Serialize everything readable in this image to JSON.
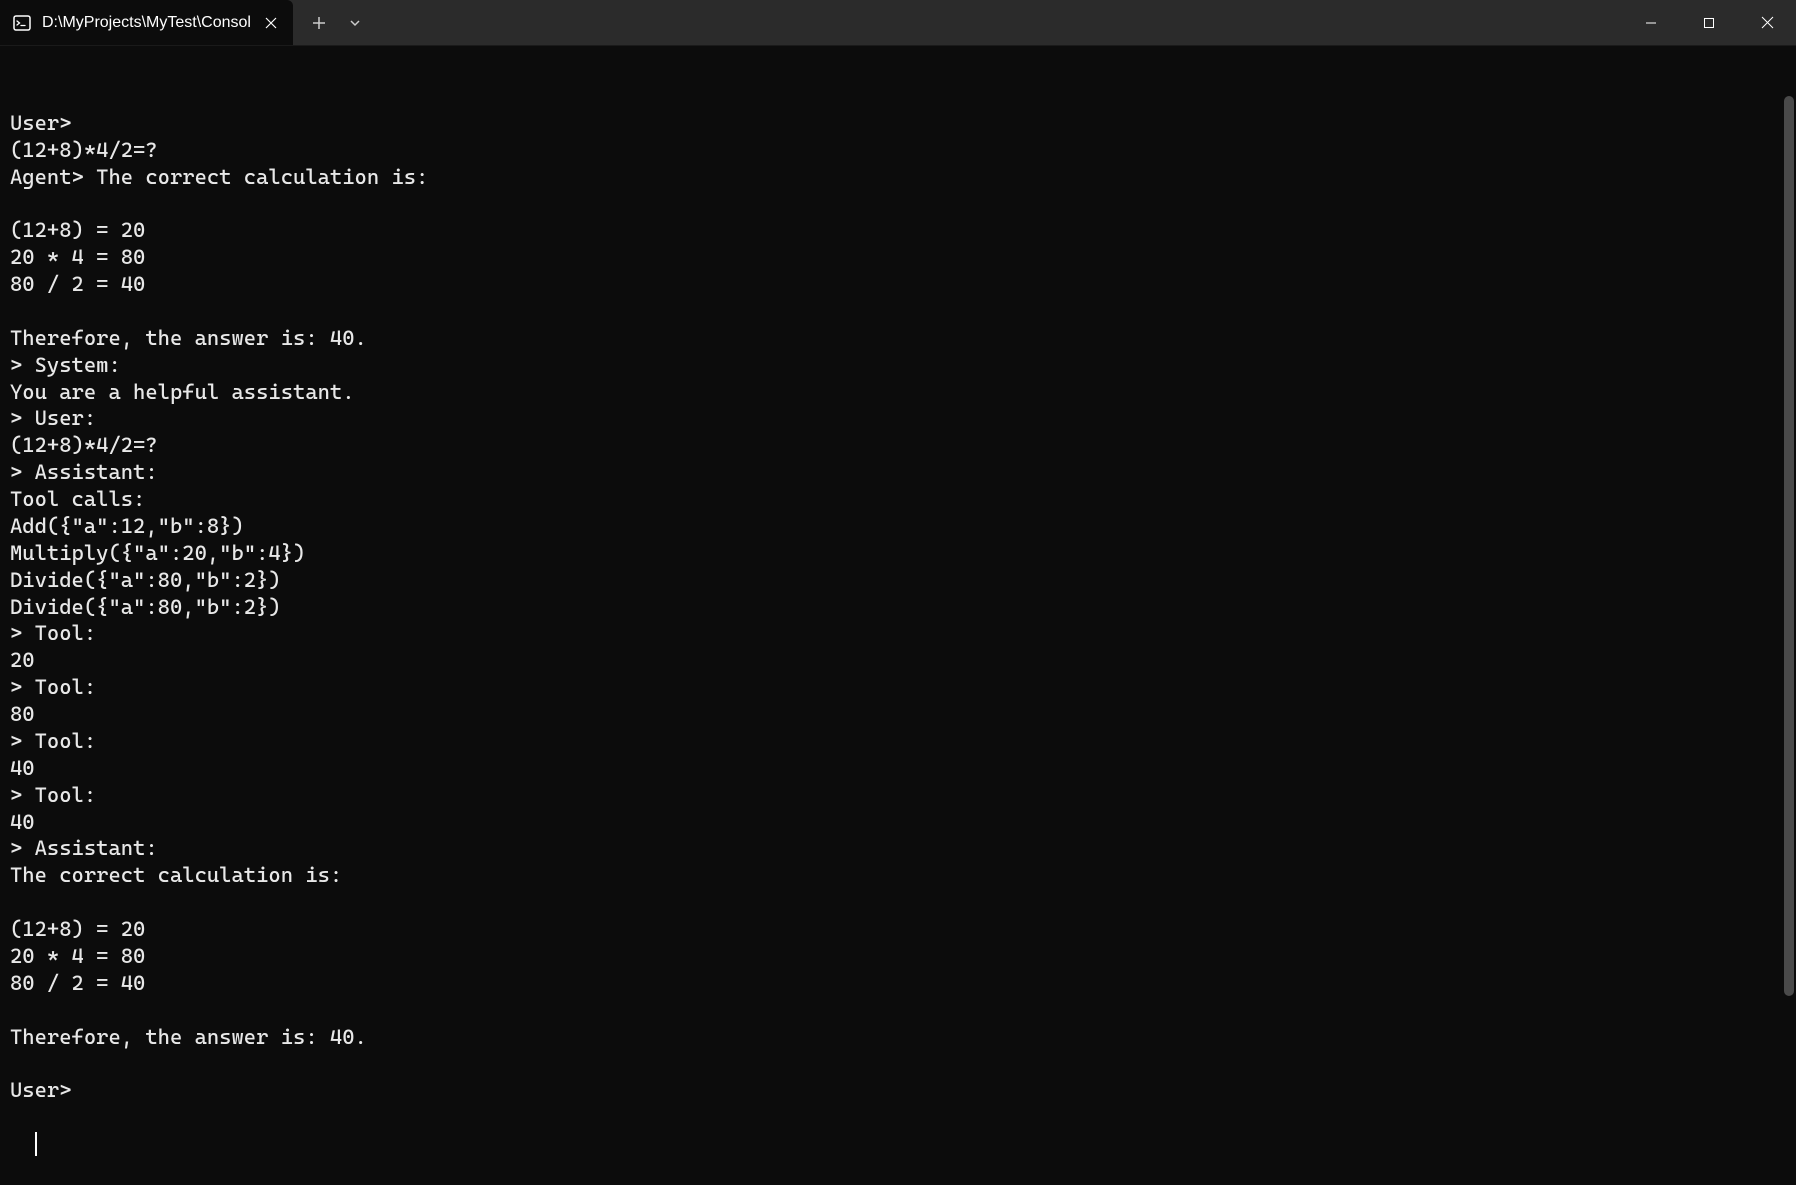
{
  "titlebar": {
    "tab_title": "D:\\MyProjects\\MyTest\\Consol"
  },
  "terminal": {
    "lines": [
      "User>",
      "(12+8)*4/2=?",
      "Agent> The correct calculation is:",
      "",
      "(12+8) = 20",
      "20 * 4 = 80",
      "80 / 2 = 40",
      "",
      "Therefore, the answer is: 40.",
      "> System:",
      "You are a helpful assistant.",
      "> User:",
      "(12+8)*4/2=?",
      "> Assistant:",
      "Tool calls:",
      "Add({\"a\":12,\"b\":8})",
      "Multiply({\"a\":20,\"b\":4})",
      "Divide({\"a\":80,\"b\":2})",
      "Divide({\"a\":80,\"b\":2})",
      "> Tool:",
      "20",
      "> Tool:",
      "80",
      "> Tool:",
      "40",
      "> Tool:",
      "40",
      "> Assistant:",
      "The correct calculation is:",
      "",
      "(12+8) = 20",
      "20 * 4 = 80",
      "80 / 2 = 40",
      "",
      "Therefore, the answer is: 40.",
      "",
      "User>"
    ]
  }
}
